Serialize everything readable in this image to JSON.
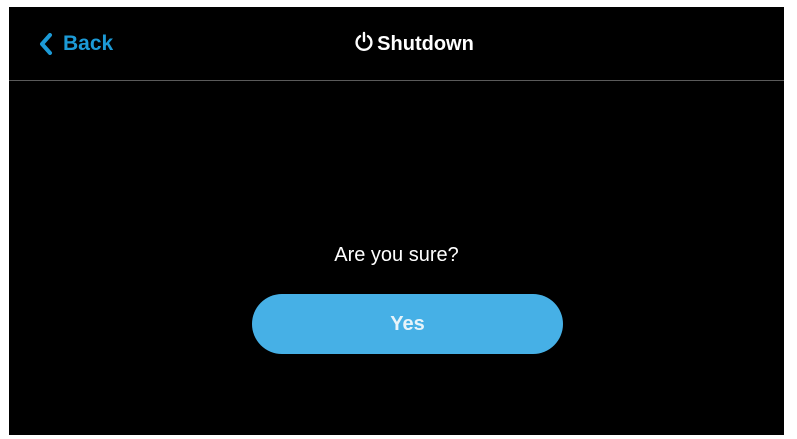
{
  "header": {
    "back_label": "Back",
    "back_icon": "chevron-left-icon",
    "title": "Shutdown",
    "title_icon": "power-icon"
  },
  "dialog": {
    "prompt": "Are you sure?",
    "confirm_label": "Yes"
  },
  "colors": {
    "background": "#000000",
    "accent": "#1c9ad6",
    "button": "#46b0e6",
    "text": "#ffffff",
    "divider": "#5a5a5a"
  }
}
